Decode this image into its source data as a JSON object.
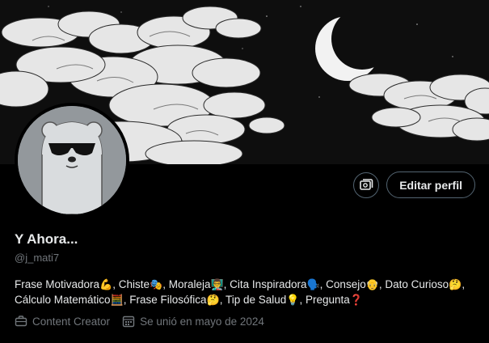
{
  "profile": {
    "name": "Y Ahora...",
    "handle": "@j_mati7",
    "edit_label": "Editar perfil"
  },
  "bio": [
    {
      "text": "Frase Motivadora",
      "emoji": "💪"
    },
    {
      "text": ", Chiste",
      "emoji": "🎭"
    },
    {
      "text": ", Moraleja",
      "emoji": "👨‍🏫"
    },
    {
      "text": ", Cita Inspiradora",
      "emoji": "🗣️"
    },
    {
      "text": ", Consejo",
      "emoji": "👴"
    },
    {
      "text": ", Dato Curioso",
      "emoji": "🤔"
    },
    {
      "text": ", Cálculo Matemático",
      "emoji": "🧮"
    },
    {
      "text": ", Frase Filosófica",
      "emoji": "🤔"
    },
    {
      "text": ", Tip de Salud",
      "emoji": "💡"
    },
    {
      "text": ", Pregunta",
      "emoji": "❓"
    }
  ],
  "meta": {
    "category": "Content Creator",
    "joined": "Se unió en mayo de 2024"
  },
  "icons": {
    "category": "briefcase-icon",
    "joined": "calendar-icon",
    "action": "settings-card-icon"
  },
  "colors": {
    "background": "#000000",
    "secondary_text": "#71767b",
    "border": "#536471"
  }
}
